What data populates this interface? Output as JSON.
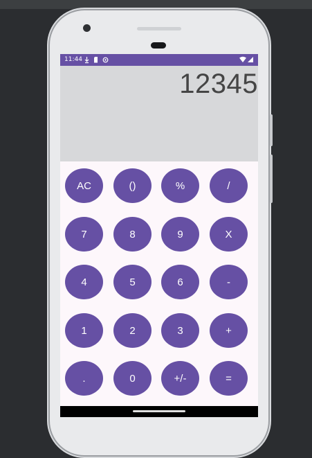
{
  "status_bar": {
    "time": "11:44",
    "left_icons": [
      "download-icon",
      "sd-card-icon",
      "sync-icon"
    ],
    "right_icons": [
      "wifi-icon",
      "signal-icon"
    ]
  },
  "display": {
    "value": "12345"
  },
  "keypad": {
    "keys": [
      {
        "label": "AC",
        "name": "clear-button"
      },
      {
        "label": "()",
        "name": "parentheses-button"
      },
      {
        "label": "%",
        "name": "percent-button"
      },
      {
        "label": "/",
        "name": "divide-button"
      },
      {
        "label": "7",
        "name": "digit-7-button"
      },
      {
        "label": "8",
        "name": "digit-8-button"
      },
      {
        "label": "9",
        "name": "digit-9-button"
      },
      {
        "label": "X",
        "name": "multiply-button"
      },
      {
        "label": "4",
        "name": "digit-4-button"
      },
      {
        "label": "5",
        "name": "digit-5-button"
      },
      {
        "label": "6",
        "name": "digit-6-button"
      },
      {
        "label": "-",
        "name": "subtract-button"
      },
      {
        "label": "1",
        "name": "digit-1-button"
      },
      {
        "label": "2",
        "name": "digit-2-button"
      },
      {
        "label": "3",
        "name": "digit-3-button"
      },
      {
        "label": "+",
        "name": "add-button"
      },
      {
        "label": ".",
        "name": "decimal-button"
      },
      {
        "label": "0",
        "name": "digit-0-button"
      },
      {
        "label": "+/-",
        "name": "sign-toggle-button"
      },
      {
        "label": "=",
        "name": "equals-button"
      }
    ]
  },
  "colors": {
    "accent": "#6650a4",
    "display_bg": "#d7d8da",
    "screen_bg": "#fdf7fb",
    "display_text": "#454545"
  }
}
